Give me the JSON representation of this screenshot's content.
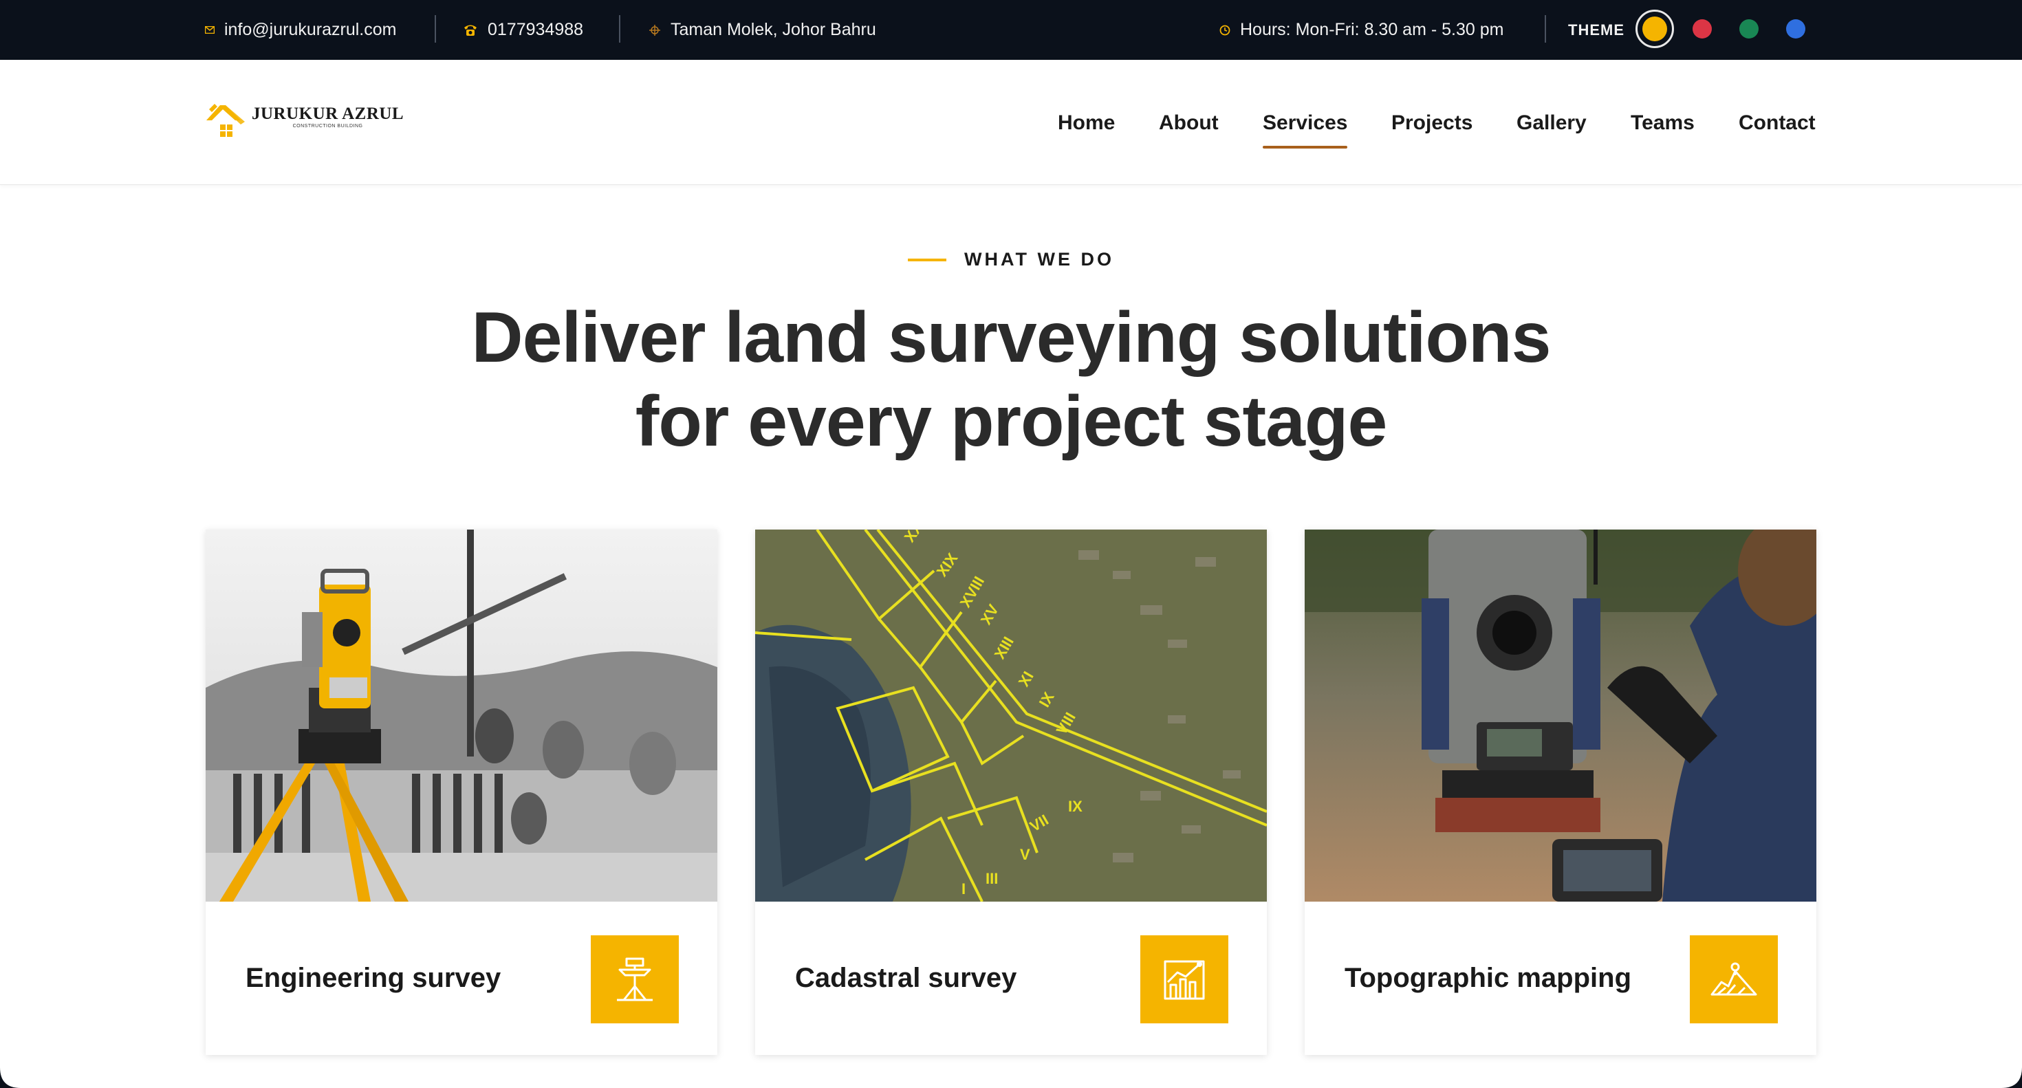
{
  "topbar": {
    "email": "info@jurukurazrul.com",
    "phone": "0177934988",
    "address": "Taman Molek, Johor Bahru",
    "hours": "Hours: Mon-Fri: 8.30 am - 5.30 pm",
    "theme_label": "THEME",
    "icons": [
      "envelope-icon",
      "phone-icon",
      "location-icon",
      "clock-icon"
    ],
    "theme_colors": [
      "#f5b400",
      "#dc3545",
      "#198754",
      "#2f6fe0"
    ]
  },
  "brand": {
    "name": "JURUKUR AZRUL",
    "tagline": "CONSTRUCTION BUILDING",
    "accent": "#f5b400"
  },
  "nav": {
    "items": [
      "Home",
      "About",
      "Services",
      "Projects",
      "Gallery",
      "Teams",
      "Contact"
    ],
    "active": "Services"
  },
  "section": {
    "eyebrow": "WHAT WE DO",
    "headline_line1": "Deliver land surveying solutions",
    "headline_line2": "for every project stage"
  },
  "services": [
    {
      "title": "Engineering survey",
      "icon": "total-station-icon"
    },
    {
      "title": "Cadastral survey",
      "icon": "chart-trend-icon"
    },
    {
      "title": "Topographic mapping",
      "icon": "terrain-map-icon"
    }
  ],
  "parcel_labels": [
    "XX",
    "XIX",
    "XVIII",
    "XV",
    "XIII",
    "XI",
    "IX",
    "VIII",
    "VII",
    "V",
    "III",
    "I",
    "IX"
  ]
}
